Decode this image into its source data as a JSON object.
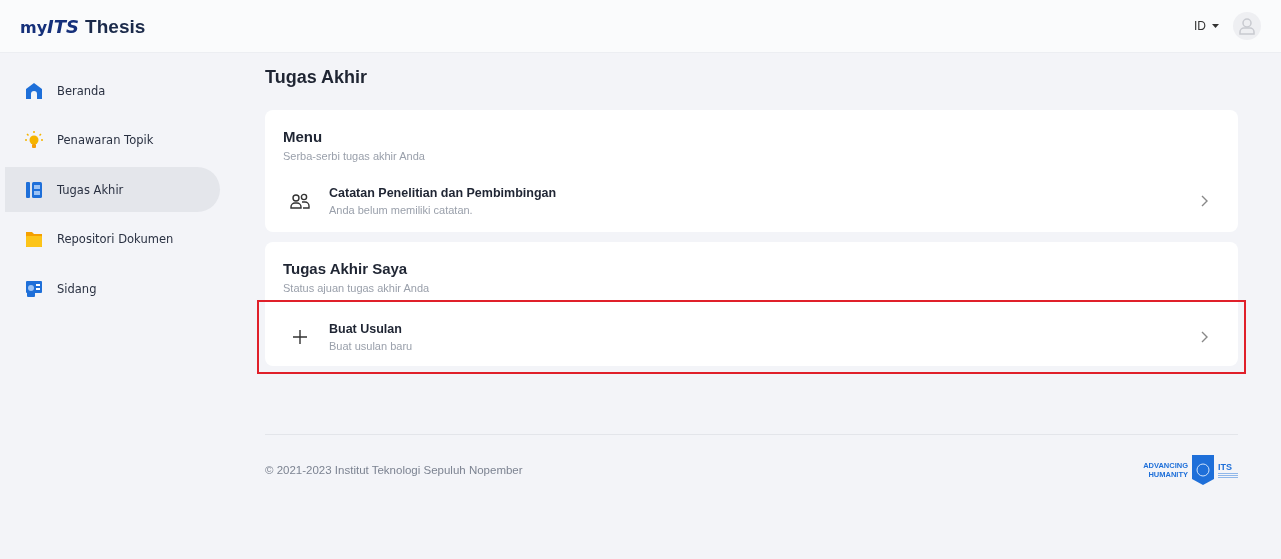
{
  "header": {
    "logo_prefix": "my",
    "logo_mark": "ITS",
    "logo_suffix": "Thesis",
    "language": "ID"
  },
  "sidebar": {
    "items": [
      {
        "label": "Beranda",
        "kind": "home",
        "selected": false
      },
      {
        "label": "Penawaran Topik",
        "kind": "bulb",
        "selected": false
      },
      {
        "label": "Tugas Akhir",
        "kind": "book",
        "selected": true
      },
      {
        "label": "Repositori Dokumen",
        "kind": "folder",
        "selected": false
      },
      {
        "label": "Sidang",
        "kind": "board",
        "selected": false
      }
    ]
  },
  "page_title": "Tugas Akhir",
  "cards": [
    {
      "title": "Menu",
      "subtitle": "Serba-serbi tugas akhir Anda",
      "items": [
        {
          "kind": "people",
          "title": "Catatan Penelitian dan Pembimbingan",
          "subtitle": "Anda belum memiliki catatan.",
          "highlighted": false
        }
      ]
    },
    {
      "title": "Tugas Akhir Saya",
      "subtitle": "Status ajuan tugas akhir Anda",
      "items": [
        {
          "kind": "plus",
          "title": "Buat Usulan",
          "subtitle": "Buat usulan baru",
          "highlighted": true
        }
      ]
    }
  ],
  "footer": {
    "copyright": "© 2021-2023 Institut Teknologi Sepuluh Nopember",
    "logo_line_1": "ADVANCING",
    "logo_line_2": "HUMANITY",
    "logo_mark": "ITS"
  }
}
